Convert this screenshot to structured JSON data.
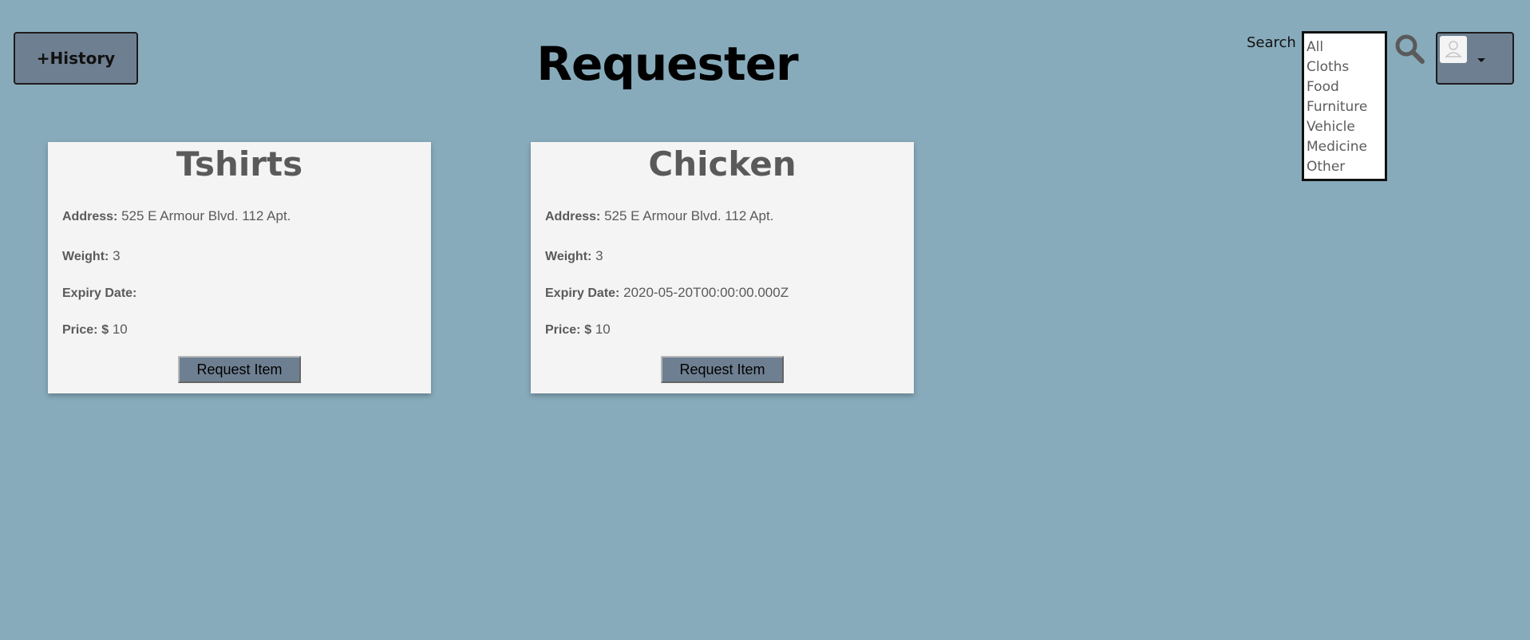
{
  "colors": {
    "background": "#87abbb",
    "button": "#6e7f91",
    "card": "#f4f4f4",
    "card_text": "#5a5a5a"
  },
  "header": {
    "history_label": "+History",
    "title": "Requester",
    "search_label": "Search",
    "categories": [
      "All",
      "Cloths",
      "Food",
      "Furniture",
      "Vehicle",
      "Medicine",
      "Other"
    ],
    "search_icon": "magnifier-icon",
    "user_icon": "user-avatar-icon",
    "dropdown_icon": "caret-down-icon"
  },
  "labels": {
    "address": "Address:",
    "weight": "Weight:",
    "expiry": "Expiry Date:",
    "price": "Price:",
    "currency": "$"
  },
  "items": [
    {
      "title": "Tshirts",
      "address": "525 E Armour Blvd. 112 Apt.",
      "weight": "3",
      "expiry": "",
      "price": "10",
      "button": "Request Item"
    },
    {
      "title": "Chicken",
      "address": "525 E Armour Blvd. 112 Apt.",
      "weight": "3",
      "expiry": "2020-05-20T00:00:00.000Z",
      "price": "10",
      "button": "Request Item"
    }
  ]
}
